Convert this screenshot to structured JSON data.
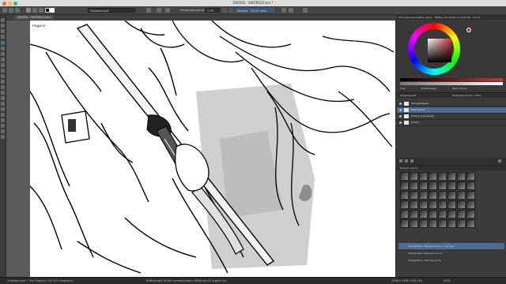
{
  "app": {
    "window_title": "SWORD - SWORD23.kra *",
    "doc_tab": "SWORD - SWORD23.kra"
  },
  "toolbar": {
    "blend_mode": "Нормальный",
    "opacity_label": "Непрозрачность:",
    "opacity_value": "1,00",
    "size_label": "Размер:",
    "size_value": "30,00 пикс"
  },
  "canvas": {
    "corner_label": "РЕДИСК"
  },
  "right_panel": {
    "tabs": [
      "Расширенный выбор цвета",
      "Выбор кисти(ей) из палитры",
      "Сетка"
    ],
    "color_footer": [
      "Уже",
      "Заодно(ещё)",
      "Цвета Фона"
    ],
    "layers_blend": "Нормальный",
    "layers_opacity": "Непрозрачность: 100%",
    "layers": [
      {
        "name": "Фигура/линии",
        "selected": false
      },
      {
        "name": "Цвет-волос",
        "selected": true
      },
      {
        "name": "Слой 2 (основной)",
        "selected": false
      },
      {
        "name": "Слой 1",
        "selected": false
      }
    ],
    "brush_tag": "Пресет: кисти",
    "brush_presets": [
      {
        "name": "abbreviation: Базовая кисть - мягкая",
        "selected": true
      },
      {
        "name": "abbreviation: Базовая кисть",
        "selected": false
      },
      {
        "name": "abbreviation: Мягкая кисть",
        "selected": false
      }
    ]
  },
  "status": {
    "left": "Клавиатура ← Esc: Выйти | Ctrl+Z: Отменить",
    "center": "RGB/Альфа (8-бит целое/канал) sRGB-elle-V2-srgbtrc.icc",
    "right": "2908 x 2460 (165,1M)",
    "zoom": "100%"
  },
  "colors": {
    "accent_selection": "#4d6f95",
    "current_color": "#c03a3a"
  }
}
